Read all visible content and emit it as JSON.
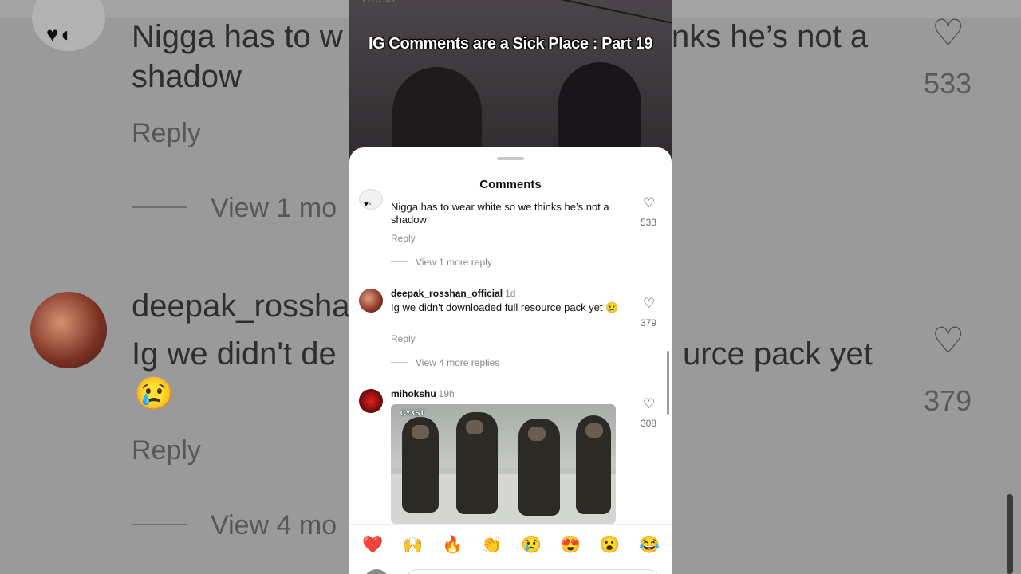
{
  "video": {
    "title": "IG Comments are a Sick Place : Part 19",
    "status_text": "Reels"
  },
  "sheet": {
    "title": "Comments"
  },
  "comments": [
    {
      "username": "",
      "time": "",
      "text": "Nigga has to wear white so we thinks he’s not a shadow",
      "reply": "Reply",
      "view_replies": "View 1 more reply",
      "likes": "533"
    },
    {
      "username": "deepak_rosshan_official",
      "time": "1d",
      "text": "Ig we didn't downloaded full resource pack yet 😢",
      "reply": "Reply",
      "view_replies": "View 4 more replies",
      "likes": "379"
    },
    {
      "username": "mihokshu",
      "time": "19h",
      "gif_logo": "CYXST",
      "likes": "308"
    }
  ],
  "emojis": [
    "❤️",
    "🙌",
    "🔥",
    "👏",
    "😢",
    "😍",
    "😮",
    "😂"
  ],
  "background": {
    "c1_line1": "Nigga has to w",
    "c1_line1_right": "nks he’s not a",
    "c1_line2": "shadow",
    "reply": "Reply",
    "view1": "View 1 mo",
    "c2_user": "deepak_rossha",
    "c2_line1": "Ig we didn't de",
    "c2_line1_right": "urce pack yet",
    "view2": "View 4 mo",
    "likes1": "533",
    "likes2": "379"
  },
  "colors": {
    "sheet": "#ffffff",
    "muted_text": "#8a8a8a",
    "heart_red": "#e0245e"
  }
}
